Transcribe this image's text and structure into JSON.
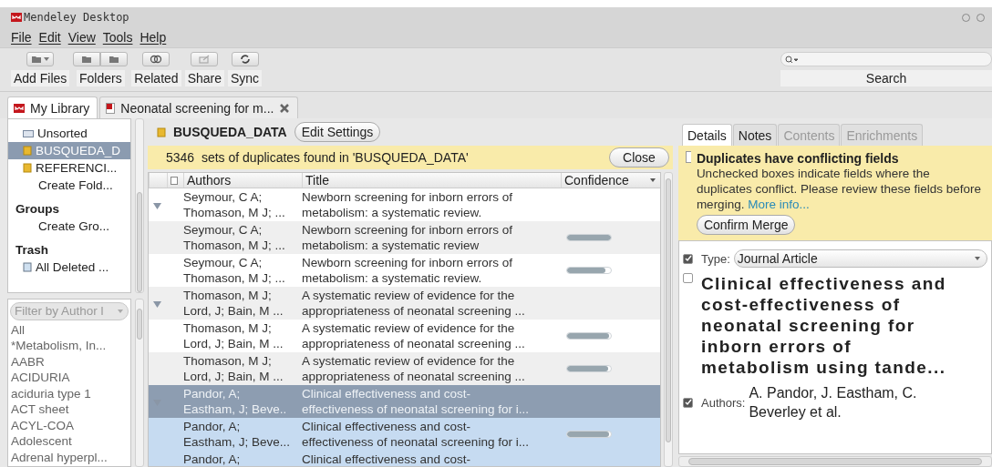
{
  "window": {
    "title": "Mendeley Desktop"
  },
  "menu": [
    "File",
    "Edit",
    "View",
    "Tools",
    "Help"
  ],
  "toolbar": [
    {
      "label": "Add Files",
      "kind": "add"
    },
    {
      "label": "Folders",
      "kind": "folders"
    },
    {
      "label": "Related",
      "kind": "related"
    },
    {
      "label": "Share",
      "kind": "share"
    },
    {
      "label": "Sync",
      "kind": "sync"
    }
  ],
  "search": {
    "label": "Search"
  },
  "tabs": [
    {
      "label": "My Library",
      "kind": "library",
      "selected": true
    },
    {
      "label": "Neonatal screening for m...",
      "kind": "pdf",
      "selected": false
    }
  ],
  "sidebar": {
    "items": [
      {
        "label": "Unsorted",
        "kind": "unsorted",
        "selected": false
      },
      {
        "label": "BUSQUEDA_D",
        "kind": "folder",
        "selected": true
      },
      {
        "label": "REFERENCI...",
        "kind": "folder",
        "selected": false
      },
      {
        "label": "Create Fold...",
        "kind": "action",
        "selected": false
      },
      {
        "label": "Groups",
        "kind": "heading",
        "selected": false
      },
      {
        "label": "Create Gro...",
        "kind": "action",
        "selected": false
      },
      {
        "label": "Trash",
        "kind": "heading",
        "selected": false
      },
      {
        "label": "All Deleted ...",
        "kind": "trash",
        "selected": false
      }
    ]
  },
  "filter": {
    "placeholder": "Filter by Author l",
    "items": [
      "All",
      "*Metabolism, In...",
      "AABR",
      "ACIDURIA",
      "aciduria type 1",
      "ACT sheet",
      "ACYL-COA",
      "Adolescent",
      "Adrenal hyperpl..."
    ]
  },
  "folder_header": {
    "title": "BUSQUEDA_DATA",
    "button": "Edit Settings"
  },
  "duplicates_bar": {
    "message": "5346  sets of duplicates found in 'BUSQUEDA_DATA'",
    "button": "Close"
  },
  "table": {
    "columns": [
      "Authors",
      "Title",
      "Confidence"
    ],
    "rows": [
      {
        "authors": [
          "Seymour, C A;",
          "Thomason, M J; ..."
        ],
        "title": [
          "Newborn screening for inborn errors of",
          "metabolism: a systematic review."
        ],
        "kind": "group",
        "selected": false,
        "highlighted": false
      },
      {
        "authors": [
          "Seymour, C A;",
          "Thomason, M J; ..."
        ],
        "title": [
          "Newborn screening for inborn errors of",
          "metabolism: a systematic review"
        ],
        "kind": "item",
        "level": 1.0,
        "selected": false,
        "highlighted": false
      },
      {
        "authors": [
          "Seymour, C A;",
          "Thomason, M J; ..."
        ],
        "title": [
          "Newborn screening for inborn errors of",
          "metabolism: a systematic review."
        ],
        "kind": "item",
        "level": 0.88,
        "selected": false,
        "highlighted": false
      },
      {
        "authors": [
          "Thomason, M J;",
          "Lord, J; Bain, M ..."
        ],
        "title": [
          "A systematic review of evidence for the",
          "appropriateness of neonatal screening ..."
        ],
        "kind": "group",
        "selected": false,
        "highlighted": false
      },
      {
        "authors": [
          "Thomason, M J;",
          "Lord, J; Bain, M ..."
        ],
        "title": [
          "A systematic review of evidence for the",
          "appropriateness of neonatal screening ..."
        ],
        "kind": "item",
        "level": 0.95,
        "selected": false,
        "highlighted": false
      },
      {
        "authors": [
          "Thomason, M J;",
          "Lord, J; Bain, M ..."
        ],
        "title": [
          "A systematic review of evidence for the",
          "appropriateness of neonatal screening ..."
        ],
        "kind": "item",
        "level": 0.93,
        "selected": false,
        "highlighted": false
      },
      {
        "authors": [
          "Pandor, A;",
          "Eastham, J; Beve.."
        ],
        "title": [
          "Clinical effectiveness and cost-",
          "effectiveness of neonatal screening for i..."
        ],
        "kind": "group",
        "selected": true,
        "highlighted": false
      },
      {
        "authors": [
          "Pandor, A;",
          "Eastham, J; Beve..."
        ],
        "title": [
          "Clinical effectiveness and cost-",
          "effectiveness of neonatal screening for i..."
        ],
        "kind": "item",
        "level": 0.95,
        "selected": false,
        "highlighted": true
      },
      {
        "authors": [
          "Pandor, A;"
        ],
        "title": [
          "Clinical effectiveness and cost-"
        ],
        "kind": "item",
        "selected": false,
        "highlighted": true
      }
    ]
  },
  "details": {
    "tabs": [
      {
        "label": "Details",
        "selected": true,
        "disabled": false
      },
      {
        "label": "Notes",
        "selected": false,
        "disabled": false
      },
      {
        "label": "Contents",
        "selected": false,
        "disabled": true
      },
      {
        "label": "Enrichments",
        "selected": false,
        "disabled": true
      }
    ],
    "notice": {
      "title": "Duplicates have conflicting fields",
      "text": "Unchecked boxes indicate fields where the duplicates conflict. Please review these fields before merging.",
      "link": "More info...",
      "button": "Confirm Merge"
    },
    "fields": [
      {
        "kind": "type",
        "label": "Type:",
        "value": "Journal Article",
        "checked": true
      },
      {
        "kind": "title",
        "value": "Clinical effectiveness and cost-effectiveness of neonatal screening for inborn errors of metabolism using tande...",
        "checked": false
      },
      {
        "kind": "authors",
        "label": "Authors:",
        "value": "A. Pandor, J. Eastham, C. Beverley et al.",
        "checked": true
      }
    ]
  }
}
